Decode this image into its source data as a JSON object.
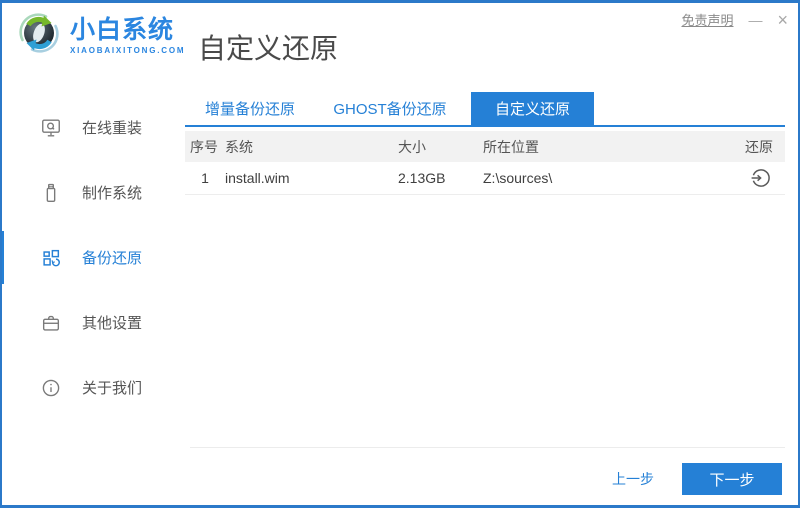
{
  "brand": {
    "name": "小白系统",
    "domain": "XIAOBAIXITONG.COM"
  },
  "header": {
    "page_title": "自定义还原"
  },
  "titlebar": {
    "disclaimer": "免责声明",
    "minimize": "—",
    "close": "×"
  },
  "sidebar": {
    "items": [
      {
        "label": "在线重装",
        "icon": "monitor-icon",
        "active": false
      },
      {
        "label": "制作系统",
        "icon": "usb-drive-icon",
        "active": false
      },
      {
        "label": "备份还原",
        "icon": "blocks-restore-icon",
        "active": true
      },
      {
        "label": "其他设置",
        "icon": "briefcase-icon",
        "active": false
      },
      {
        "label": "关于我们",
        "icon": "info-icon",
        "active": false
      }
    ]
  },
  "tabs": [
    {
      "label": "增量备份还原",
      "active": false
    },
    {
      "label": "GHOST备份还原",
      "active": false
    },
    {
      "label": "自定义还原",
      "active": true
    }
  ],
  "table": {
    "headers": [
      "序号",
      "系统",
      "大小",
      "所在位置",
      "还原"
    ],
    "rows": [
      {
        "index": "1",
        "system": "install.wim",
        "size": "2.13GB",
        "location": "Z:\\sources\\",
        "action": "restore-icon"
      }
    ]
  },
  "footer": {
    "prev": "上一步",
    "next": "下一步"
  },
  "colors": {
    "accent": "#2580d6",
    "window_border": "#2b79c9",
    "table_header_bg": "#f2f2f2"
  }
}
